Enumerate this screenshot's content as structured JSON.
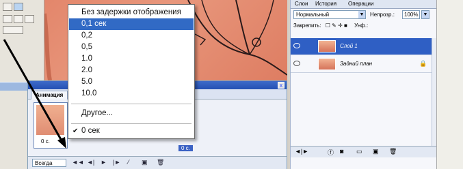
{
  "menu": {
    "items": [
      "Без задержки отображения",
      "0,1 сек",
      "0,2",
      "0,5",
      "1.0",
      "2.0",
      "5.0",
      "10.0"
    ],
    "selected_index": 1,
    "other_label": "Другое...",
    "current_label": "0 сек"
  },
  "animation_panel": {
    "tab_label": "Анимация",
    "close_glyph": "x",
    "frame_delay": "0 с.",
    "frame2_delay": "0 с.",
    "loop_value": "Всегда",
    "controls": [
      "◄◄",
      "◄|",
      "►",
      "|►",
      "⁄",
      "▣",
      "🗑"
    ]
  },
  "layers_panel": {
    "tabs": [
      "Слои",
      "История",
      "Операции"
    ],
    "blend_mode": "Нормальный",
    "opacity_label": "Непрозр.:",
    "opacity_value": "100%",
    "lock_label": "Закрепить:",
    "fill_label": "Унф.:",
    "layers": [
      {
        "name": "Слой 1",
        "selected": true
      },
      {
        "name": "Задний план",
        "selected": false
      }
    ]
  },
  "colors": {
    "menu_highlight": "#316ac5",
    "canvas": "#e3866b",
    "titlebar": "#2450b3"
  }
}
